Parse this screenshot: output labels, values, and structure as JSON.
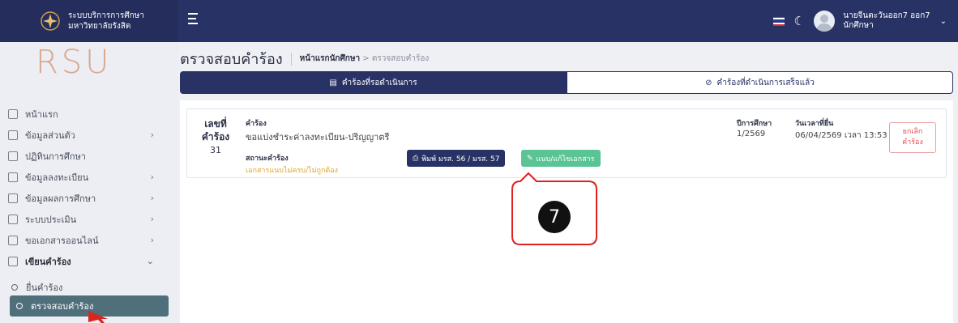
{
  "app": {
    "brand_line1": "ระบบบริการการศึกษา",
    "brand_line2": "มหาวิทยาลัยรังสิต",
    "logo_text": "RSU"
  },
  "topbar": {
    "user_name": "นายจีนตะวันออก7 ออก7",
    "user_role": "นักศึกษา",
    "icons": [
      "menu-icon",
      "thai-flag-icon",
      "moon-icon",
      "avatar-icon",
      "chevron-down-icon"
    ]
  },
  "sidebar": {
    "items": [
      {
        "label": "หน้าแรก",
        "icon": "home-icon",
        "has_arrow": false
      },
      {
        "label": "ข้อมูลส่วนตัว",
        "icon": "id-card-icon",
        "has_arrow": true
      },
      {
        "label": "ปฏิทินการศึกษา",
        "icon": "calendar-icon",
        "has_arrow": false
      },
      {
        "label": "ข้อมูลลงทะเบียน",
        "icon": "register-icon",
        "has_arrow": true
      },
      {
        "label": "ข้อมูลผลการศึกษา",
        "icon": "grade-icon",
        "has_arrow": true
      },
      {
        "label": "ระบบประเมิน",
        "icon": "clipboard-icon",
        "has_arrow": true
      },
      {
        "label": "ขอเอกสารออนไลน์",
        "icon": "document-icon",
        "has_arrow": true
      },
      {
        "label": "เขียนคำร้อง",
        "icon": "edit-icon",
        "has_arrow": true
      }
    ],
    "submenu": {
      "submit": "ยื่นคำร้อง",
      "check": "ตรวจสอบคำร้อง"
    }
  },
  "page": {
    "title": "ตรวจสอบคำร้อง",
    "breadcrumb_home": "หน้าแรกนักศึกษา",
    "breadcrumb_sep": ">",
    "breadcrumb_current": "ตรวจสอบคำร้อง"
  },
  "tabs": {
    "pending": "คำร้องที่รอดำเนินการ",
    "completed": "คำร้องที่ดำเนินการเสร็จแล้ว"
  },
  "request": {
    "no_label_1": "เลขที่",
    "no_label_2": "คำร้อง",
    "no": "31",
    "req_label": "คำร้อง",
    "req_value": "ขอแบ่งชำระค่าลงทะเบียน-ปริญญาตรี",
    "status_label": "สถานะคำร้อง",
    "status_value": "เอกสารแนบไม่ครบ/ไม่ถูกต้อง",
    "year_label": "ปีการศึกษา",
    "year_value": "1/2569",
    "date_label": "วันเวลาที่ยื่น",
    "date_value": "06/04/2569 เวลา 13:53",
    "print_label": "พิมพ์ มรส. 56 / มรส. 57",
    "attach_label": "แนบ/แก้ไขเอกสาร",
    "cancel_line1": "ยกเลิก",
    "cancel_line2": "คำร้อง"
  },
  "annotation": {
    "step": "7"
  },
  "colors": {
    "navy": "#283264",
    "green": "#5bc494",
    "status_warning": "#e0a526",
    "cancel_red": "#e05050",
    "callout_red": "#e02020"
  }
}
